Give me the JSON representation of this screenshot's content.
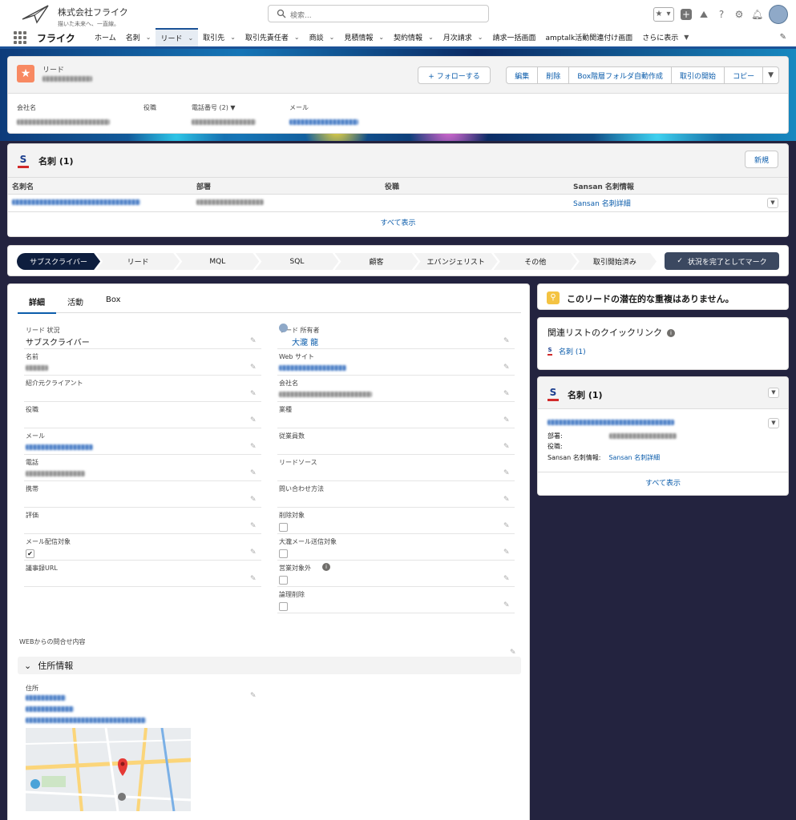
{
  "header": {
    "company_name": "株式会社フライク",
    "company_slogan": "描いた未来へ、一直線。",
    "search_placeholder": "検索...",
    "app_name": "フライク"
  },
  "nav": {
    "tabs": [
      {
        "label": "ホーム",
        "chevron": false,
        "active": false
      },
      {
        "label": "名刺",
        "chevron": true,
        "active": false
      },
      {
        "label": "リード",
        "chevron": true,
        "active": true
      },
      {
        "label": "取引先",
        "chevron": true,
        "active": false
      },
      {
        "label": "取引先責任者",
        "chevron": true,
        "active": false
      },
      {
        "label": "商談",
        "chevron": true,
        "active": false
      },
      {
        "label": "見積情報",
        "chevron": true,
        "active": false
      },
      {
        "label": "契約情報",
        "chevron": true,
        "active": false
      },
      {
        "label": "月次請求",
        "chevron": true,
        "active": false
      },
      {
        "label": "請求一括画面",
        "chevron": false,
        "active": false
      },
      {
        "label": "amptalk活動関連付け画面",
        "chevron": false,
        "active": false
      },
      {
        "label": "さらに表示",
        "chevron": true,
        "active": false
      }
    ]
  },
  "record": {
    "object_label": "リード",
    "follow_label": "+ フォローする",
    "actions": [
      "編集",
      "削除",
      "Box階層フォルダ自動作成",
      "取引の開始",
      "コピー"
    ],
    "fields": [
      {
        "label": "会社名"
      },
      {
        "label": "役職"
      },
      {
        "label": "電話番号 (2) ▼"
      },
      {
        "label": "メール"
      }
    ]
  },
  "meishi_related": {
    "title": "名刺 (1)",
    "new_label": "新規",
    "columns": [
      "名刺名",
      "部署",
      "役職",
      "Sansan 名刺情報"
    ],
    "row_link": "Sansan 名刺詳細",
    "show_all": "すべて表示"
  },
  "path": {
    "steps": [
      "サブスクライバー",
      "リード",
      "MQL",
      "SQL",
      "顧客",
      "エバンジェリスト",
      "その他",
      "取引開始済み"
    ],
    "current": 0,
    "mark_label": "状況を完了としてマーク"
  },
  "details": {
    "tabs": [
      "詳細",
      "活動",
      "Box"
    ],
    "left_fields": [
      {
        "label": "リード 状況",
        "value": "サブスクライバー"
      },
      {
        "label": "名前",
        "value": ""
      },
      {
        "label": "紹介元クライアント",
        "value": ""
      },
      {
        "label": "役職",
        "value": ""
      },
      {
        "label": "メール",
        "value": ""
      },
      {
        "label": "電話",
        "value": ""
      },
      {
        "label": "携帯",
        "value": ""
      },
      {
        "label": "評価",
        "value": ""
      },
      {
        "label": "メール配信対象",
        "value": ""
      },
      {
        "label": "議事録URL",
        "value": ""
      }
    ],
    "right_fields": [
      {
        "label": "リード 所有者",
        "value": "大瀧 龍"
      },
      {
        "label": "Web サイト",
        "value": ""
      },
      {
        "label": "会社名",
        "value": ""
      },
      {
        "label": "業種",
        "value": ""
      },
      {
        "label": "従業員数",
        "value": ""
      },
      {
        "label": "リードソース",
        "value": ""
      },
      {
        "label": "問い合わせ方法",
        "value": ""
      },
      {
        "label": "削除対象",
        "value": ""
      },
      {
        "label": "大瀧メール送信対象",
        "value": ""
      },
      {
        "label": "営業対象外",
        "value": ""
      },
      {
        "label": "論理削除",
        "value": ""
      }
    ],
    "web_inquiry_label": "WEBからの問合せ内容",
    "address_section": "住所情報",
    "address_label": "住所"
  },
  "sidebar": {
    "duplicate_text": "このリードの潜在的な重複はありません。",
    "quicklinks_title": "関連リストのクイックリンク",
    "quicklink_meishi": "名刺 (1)",
    "meishi_title": "名刺 (1)",
    "meishi_fields": [
      {
        "label": "部署:"
      },
      {
        "label": "役職:"
      },
      {
        "label": "Sansan 名刺情報:",
        "value": "Sansan 名刺詳細"
      }
    ],
    "show_all": "すべて表示"
  }
}
